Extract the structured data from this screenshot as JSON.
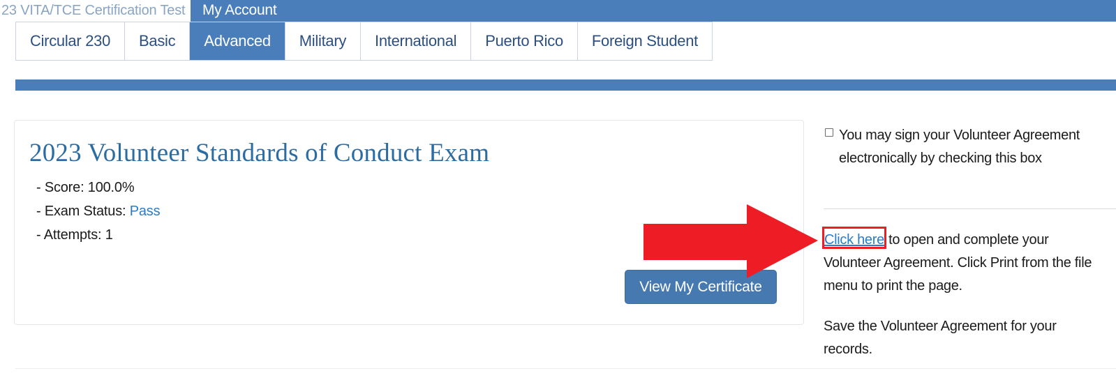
{
  "header": {
    "site_title": "23 VITA/TCE Certification Test",
    "account_tab": "My Account"
  },
  "tabs": [
    {
      "label": "Circular 230",
      "active": false
    },
    {
      "label": "Basic",
      "active": false
    },
    {
      "label": "Advanced",
      "active": true
    },
    {
      "label": "Military",
      "active": false
    },
    {
      "label": "International",
      "active": false
    },
    {
      "label": "Puerto Rico",
      "active": false
    },
    {
      "label": "Foreign Student",
      "active": false
    }
  ],
  "exam": {
    "title": "2023 Volunteer Standards of Conduct Exam",
    "score_label": "- Score: ",
    "score_value": "100.0%",
    "status_label": "- Exam Status: ",
    "status_value": "Pass",
    "attempts_label": "- Attempts: ",
    "attempts_value": "1",
    "certificate_button": "View My Certificate"
  },
  "sidebar": {
    "consent_text": "You may sign your Volunteer Agreement electronically by checking this box",
    "link_label": "Click here",
    "link_following_text": " to open and complete your Volunteer Agreement. Click Print from the file menu to print the page.",
    "save_note": "Save the Volunteer Agreement for your records."
  },
  "colors": {
    "brand_blue": "#4a7ebb",
    "link_blue": "#2b7bc8",
    "title_blue": "#2b6ca3",
    "button_blue": "#4679b0",
    "annotation_red": "#ee1c25"
  }
}
